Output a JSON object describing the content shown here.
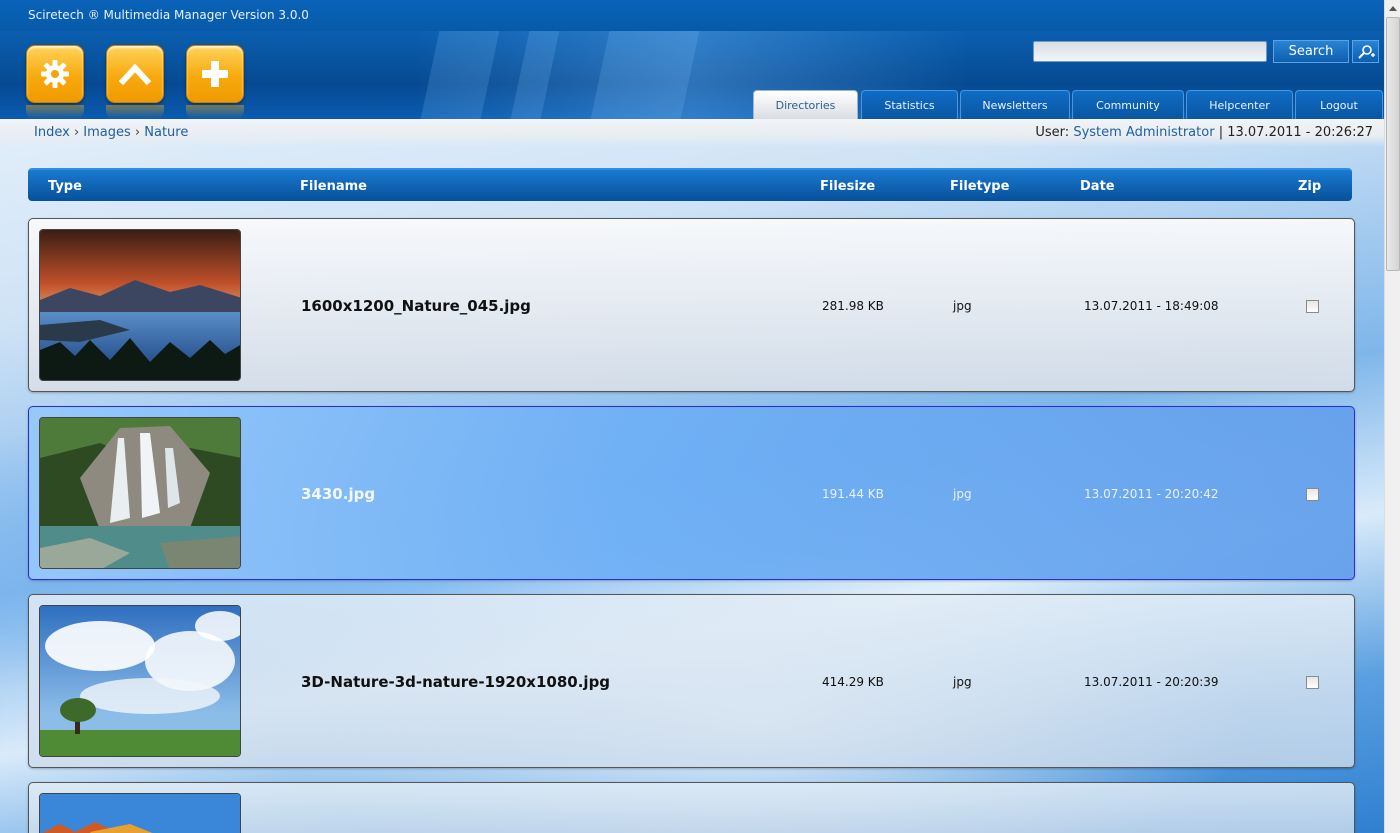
{
  "window": {
    "title": "Sciretech ® Multimedia Manager Version 3.0.0"
  },
  "toolbar": {
    "buttons": [
      {
        "name": "settings",
        "icon": "gear-icon"
      },
      {
        "name": "up",
        "icon": "chevron-up-icon"
      },
      {
        "name": "add",
        "icon": "plus-icon"
      }
    ]
  },
  "search": {
    "value": "",
    "button_label": "Search",
    "advanced_icon": "magnifier-plus-icon"
  },
  "tabs": [
    {
      "label": "Directories",
      "active": true
    },
    {
      "label": "Statistics",
      "active": false
    },
    {
      "label": "Newsletters",
      "active": false
    },
    {
      "label": "Community",
      "active": false
    },
    {
      "label": "Helpcenter",
      "active": false
    },
    {
      "label": "Logout",
      "active": false
    }
  ],
  "breadcrumb": {
    "items": [
      "Index",
      "Images",
      "Nature"
    ],
    "separator": "›"
  },
  "user": {
    "prefix": "User:",
    "name": "System Administrator",
    "separator": "|",
    "datetime": "13.07.2011 - 20:26:27"
  },
  "table": {
    "columns": [
      "Type",
      "Filename",
      "Filesize",
      "Filetype",
      "Date",
      "Zip"
    ],
    "rows": [
      {
        "filename": "1600x1200_Nature_045.jpg",
        "filesize": "281.98 KB",
        "filetype": "jpg",
        "date": "13.07.2011 - 18:49:08",
        "zip": false
      },
      {
        "filename": "3430.jpg",
        "filesize": "191.44 KB",
        "filetype": "jpg",
        "date": "13.07.2011 - 20:20:42",
        "zip": false
      },
      {
        "filename": "3D-Nature-3d-nature-1920x1080.jpg",
        "filesize": "414.29 KB",
        "filetype": "jpg",
        "date": "13.07.2011 - 20:20:39",
        "zip": false
      }
    ]
  },
  "colors": {
    "accent_orange": "#f7a90d",
    "header_blue": "#064a92",
    "link_blue": "#1d5fa3",
    "selected_row": "#6eaff5"
  }
}
